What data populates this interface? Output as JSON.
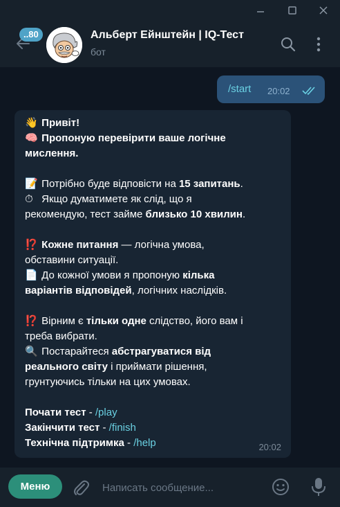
{
  "window": {
    "minimize_icon": "minimize-icon",
    "maximize_icon": "maximize-icon",
    "close_icon": "close-icon"
  },
  "header": {
    "unread_badge": "..80",
    "title": "Альберт Ейнштейн | IQ-Тест",
    "subtitle": "бот"
  },
  "outgoing": {
    "text": "/start",
    "time": "20:02"
  },
  "incoming": {
    "time": "20:02",
    "p1": {
      "greeting": "Привіт!",
      "offer_line1": "Пропоную перевірити ваше логічне",
      "offer_line2": "мислення."
    },
    "p2": {
      "need_pre": "Потрібно буде відповісти на ",
      "need_bold": "15 запитань",
      "need_post": ".",
      "if_line1": "Якщо думатимете як слід, що я",
      "rec_pre": "рекомендую, тест займе ",
      "rec_bold": "близько 10 хвилин",
      "rec_post": "."
    },
    "p3": {
      "each_bold": "Кожне питання",
      "each_rest": " — логічна умова,",
      "circ": "обставини ситуації.",
      "to_pre": "До кожної умови я пропоную ",
      "to_bold": "кілька",
      "var_bold": "варіантів відповідей",
      "var_rest": ", логічних наслідків."
    },
    "p4": {
      "true_pre": "Вірним є ",
      "true_bold": "тільки одне",
      "true_post": " слідство, його вам і",
      "choose": "треба вибрати.",
      "try_pre": "Постарайтеся ",
      "try_bold": "абстрагуватися від",
      "real_bold": "реального світу",
      "real_rest": " і приймати рішення,",
      "based": "грунтуючись тільки на цих умовах."
    },
    "p5": {
      "start_label": "Почати тест",
      "start_cmd": "/play",
      "finish_label": "Закінчити тест",
      "finish_cmd": "/finish",
      "help_label": "Технічна підтримка",
      "help_cmd": "/help",
      "sep": " - "
    },
    "emojis": {
      "wave": "👋",
      "brain": "🧠",
      "memo": "📝",
      "timer": "⏱",
      "exclaim1": "⁉️",
      "page": "📄",
      "exclaim2": "⁉️",
      "magnifier": "🔍"
    }
  },
  "composer": {
    "menu_label": "Меню",
    "placeholder": "Написать сообщение..."
  },
  "colors": {
    "background": "#0e1621",
    "header": "#17212b",
    "bubble_in": "#182533",
    "bubble_out": "#2b5278",
    "accent": "#6ad1e3",
    "menu_button": "#2c8f7a",
    "badge": "#4fa3c7"
  }
}
